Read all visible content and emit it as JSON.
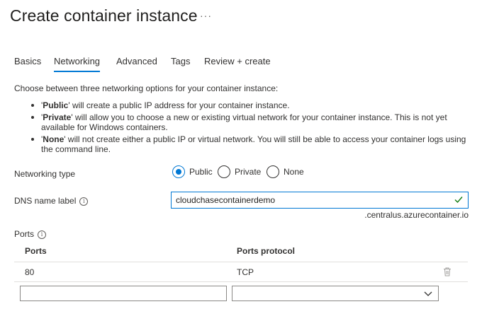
{
  "page": {
    "title": "Create container instance",
    "more_label": "···"
  },
  "tabs": [
    {
      "label": "Basics",
      "active": false
    },
    {
      "label": "Networking",
      "active": true
    },
    {
      "label": "Advanced",
      "active": false
    },
    {
      "label": "Tags",
      "active": false
    },
    {
      "label": "Review + create",
      "active": false
    }
  ],
  "intro": "Choose between three networking options for your container instance:",
  "bullets": [
    {
      "prefix": "'",
      "bold": "Public",
      "text": "' will create a public IP address for your container instance."
    },
    {
      "prefix": "'",
      "bold": "Private",
      "text": "' will allow you to choose a new or existing virtual network for your container instance. This is not yet available for Windows containers."
    },
    {
      "prefix": "'",
      "bold": "None",
      "text": "' will not create either a public IP or virtual network. You will still be able to access your container logs using the command line."
    }
  ],
  "networking_type": {
    "label": "Networking type",
    "options": [
      "Public",
      "Private",
      "None"
    ],
    "selected": "Public"
  },
  "dns": {
    "label": "DNS name label",
    "value": "cloudchasecontainerdemo",
    "suffix": ".centralus.azurecontainer.io",
    "valid": true
  },
  "ports": {
    "label": "Ports",
    "col_ports": "Ports",
    "col_protocol": "Ports protocol",
    "rows": [
      {
        "port": "80",
        "protocol": "TCP"
      }
    ],
    "new_port_value": "",
    "new_protocol_value": ""
  },
  "colors": {
    "accent": "#0078d4",
    "valid": "#107c10",
    "text": "#323130"
  },
  "icons": {
    "info": "info-icon",
    "check": "checkmark-icon",
    "delete": "trash-icon",
    "dropdown": "chevron-down-icon"
  }
}
